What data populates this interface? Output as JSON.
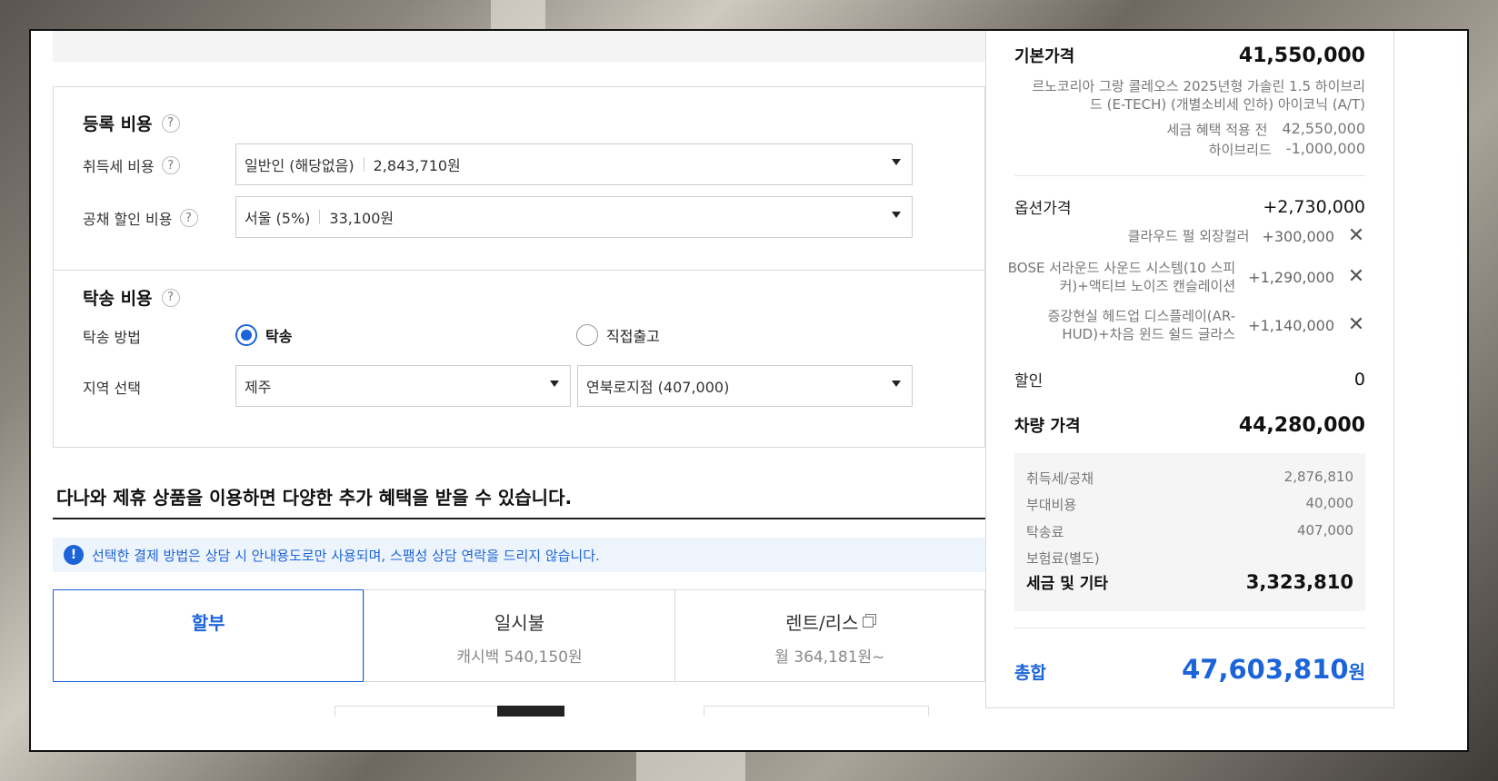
{
  "registration": {
    "title": "등록 비용",
    "help": "?",
    "acquisition_tax": {
      "label": "취득세 비용",
      "help": "?",
      "selected": "일반인 (해당없음)",
      "amount": "2,843,710원"
    },
    "bond_discount": {
      "label": "공채 할인 비용",
      "help": "?",
      "selected": "서울 (5%)",
      "amount": "33,100원"
    }
  },
  "delivery": {
    "title": "탁송 비용",
    "help": "?",
    "method": {
      "label": "탁송 방법",
      "options": [
        "탁송",
        "직접출고"
      ],
      "selected": "탁송"
    },
    "region": {
      "label": "지역 선택",
      "region_value": "제주",
      "branch_value": "연북로지점 (407,000)"
    }
  },
  "promo": {
    "title": "다나와 제휴 상품을 이용하면 다양한 추가 혜택을 받을 수 있습니다.",
    "notice": "선택한 결제 방법은 상담 시 안내용도로만 사용되며, 스팸성 상담 연락을 드리지 않습니다.",
    "notice_icon": "!",
    "tabs": [
      {
        "title": "할부",
        "sub": ""
      },
      {
        "title": "일시불",
        "sub": "캐시백 540,150원"
      },
      {
        "title": "렌트/리스",
        "sub": "월 364,181원~"
      }
    ]
  },
  "summary": {
    "base": {
      "label": "기본가격",
      "value": "41,550,000",
      "desc": "르노코리아 그랑 콜레오스 2025년형 가솔린 1.5 하이브리드 (E-TECH) (개별소비세 인하) 아이코닉 (A/T)",
      "pre_tax_label": "세금 혜택 적용 전",
      "pre_tax_value": "42,550,000",
      "hybrid_label": "하이브리드",
      "hybrid_value": "-1,000,000"
    },
    "options": {
      "label": "옵션가격",
      "value": "+2,730,000",
      "items": [
        {
          "name": "클라우드 펄 외장컬러",
          "value": "+300,000"
        },
        {
          "name": "BOSE 서라운드 사운드 시스템(10 스피커)+액티브 노이즈 캔슬레이션",
          "value": "+1,290,000"
        },
        {
          "name": "증강현실 헤드업 디스플레이(AR-HUD)+차음 윈드 쉴드 글라스",
          "value": "+1,140,000"
        }
      ],
      "remove_glyph": "✕"
    },
    "discount": {
      "label": "할인",
      "value": "0"
    },
    "vehicle_price": {
      "label": "차량 가격",
      "value": "44,280,000"
    },
    "taxes": {
      "rows": [
        {
          "label": "취득세/공채",
          "value": "2,876,810"
        },
        {
          "label": "부대비용",
          "value": "40,000"
        },
        {
          "label": "탁송료",
          "value": "407,000"
        },
        {
          "label": "보험료(별도)",
          "value": ""
        }
      ],
      "total_label": "세금 및 기타",
      "total_value": "3,323,810"
    },
    "total": {
      "label": "총합",
      "value": "47,603,810",
      "unit": "원"
    }
  },
  "colors": {
    "accent": "#1c64d9",
    "border": "#d9d9d9"
  }
}
